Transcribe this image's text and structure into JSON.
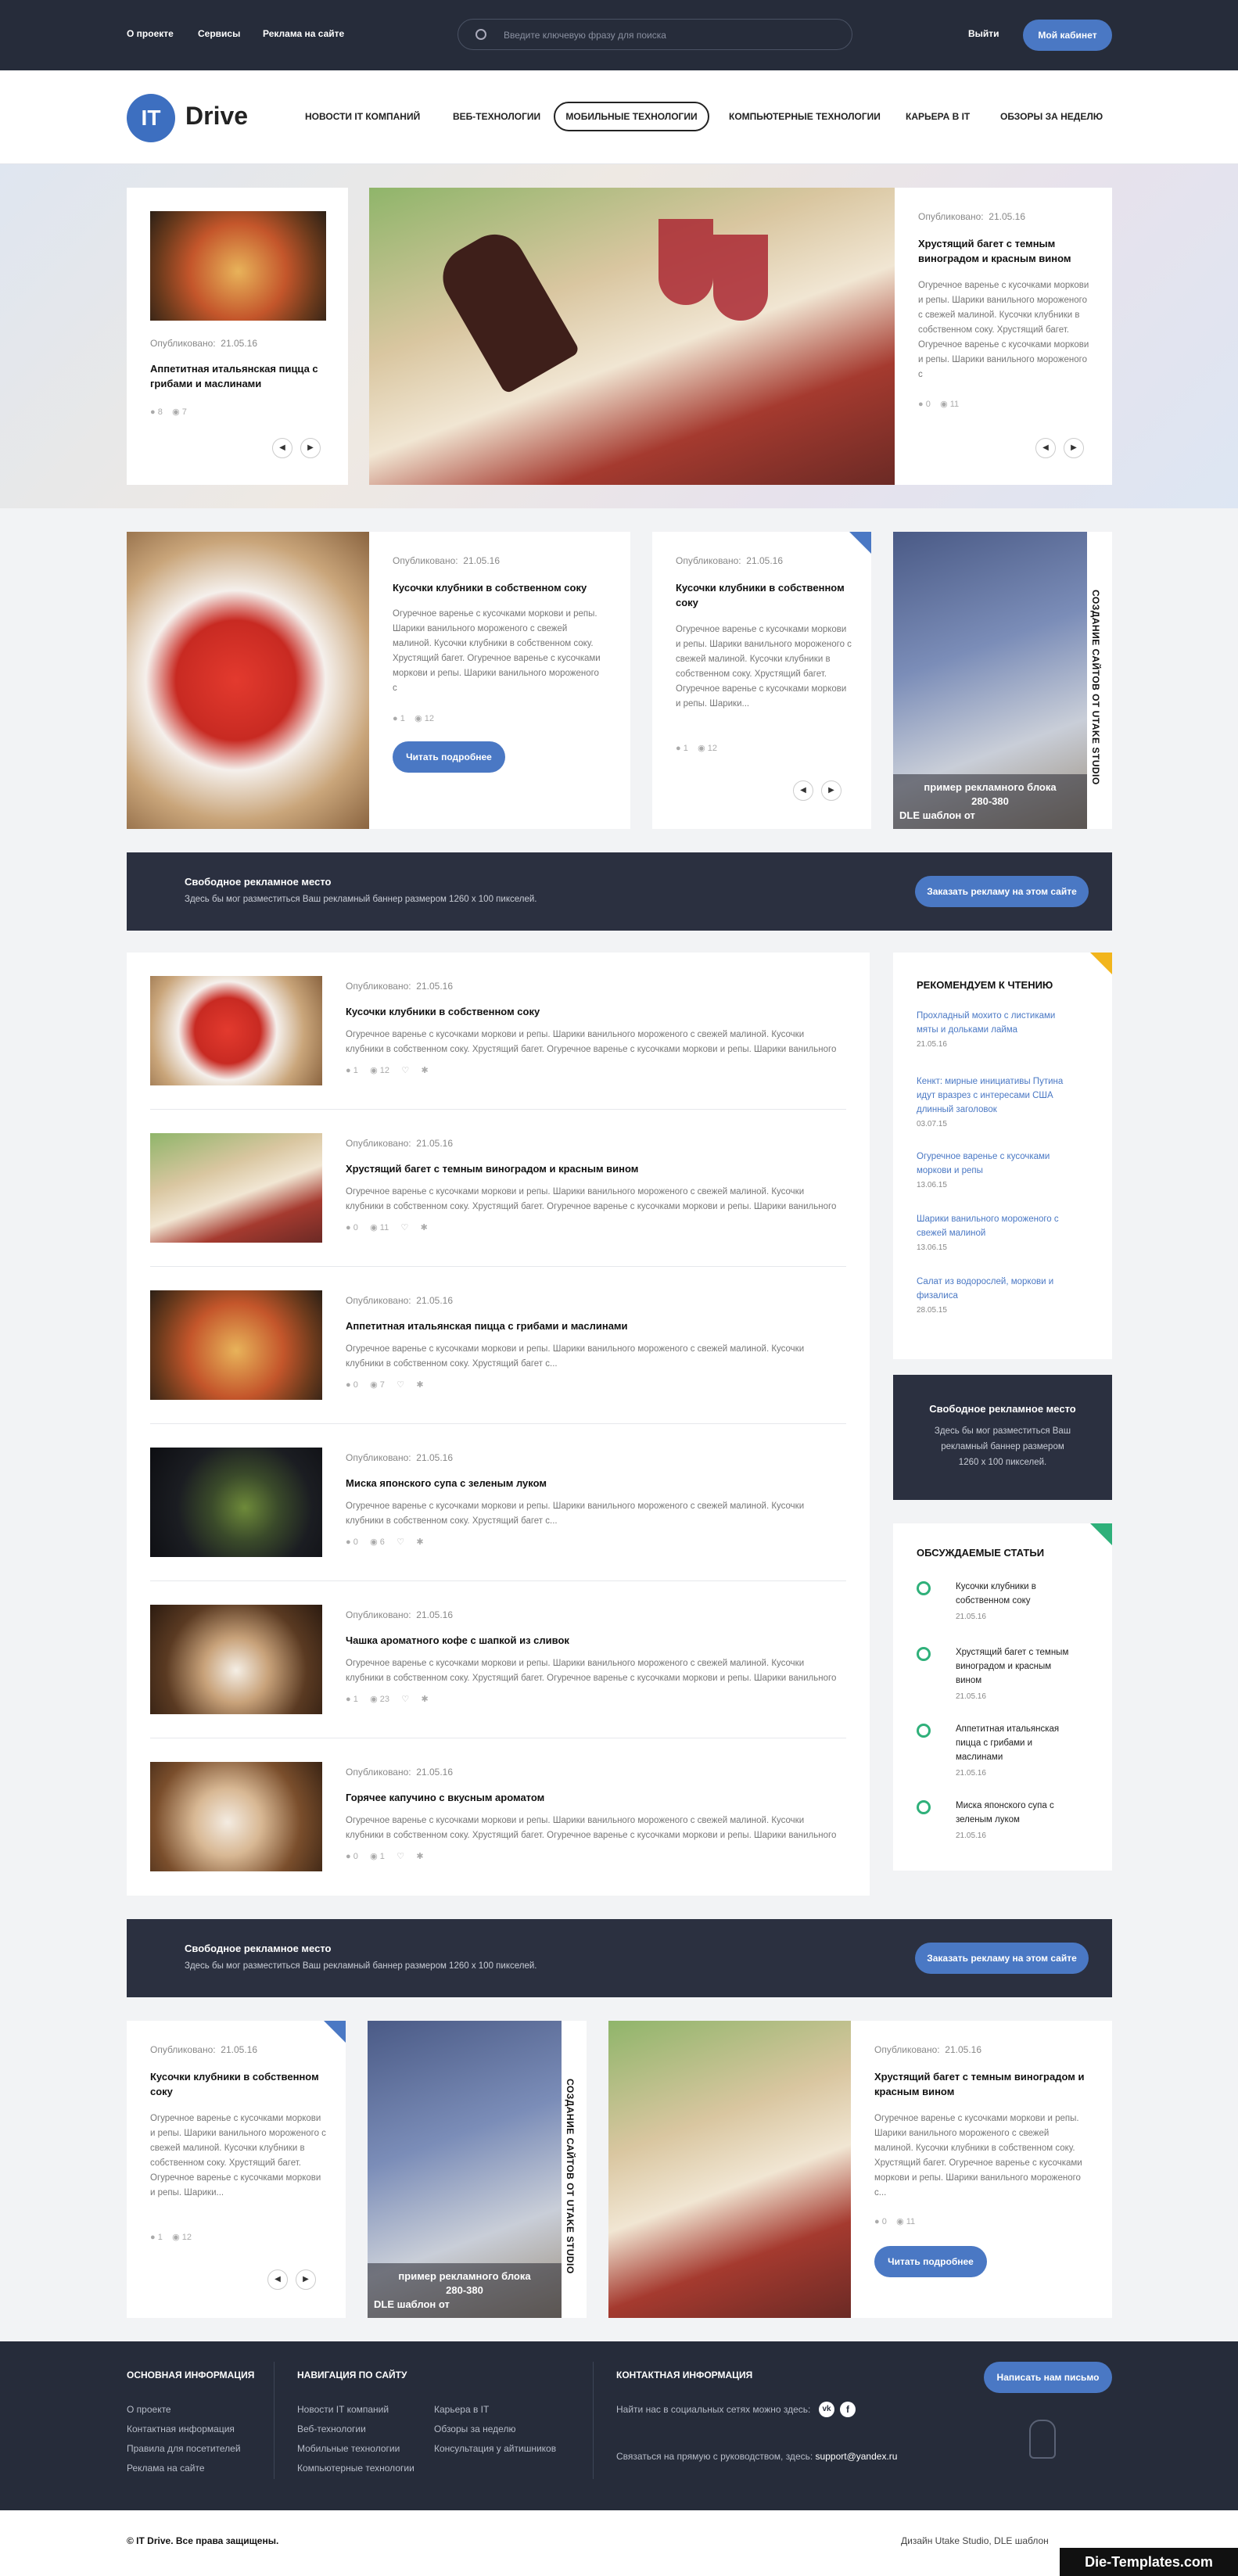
{
  "topbar": {
    "about": "О проекте",
    "services": "Сервисы",
    "ads": "Реклама на сайте",
    "search_placeholder": "Введите ключевую фразу для поиска",
    "logout": "Выйти",
    "cabinet": "Мой кабинет"
  },
  "logo": {
    "badge": "IT",
    "name": "Drive"
  },
  "nav": [
    "НОВОСТИ IT КОМПАНИЙ",
    "ВЕБ-ТЕХНОЛОГИИ",
    "МОБИЛЬНЫЕ ТЕХНОЛОГИИ",
    "КОМПЬЮТЕРНЫЕ ТЕХНОЛОГИИ",
    "КАРЬЕРА В IT",
    "ОБЗОРЫ ЗА НЕДЕЛЮ"
  ],
  "published_label": "Опубликовано:",
  "hero": {
    "left": {
      "date": "21.05.16",
      "title": "Аппетитная итальянская пицца с грибами и маслинами",
      "comments": "8",
      "views": "7"
    },
    "right": {
      "date": "21.05.16",
      "title": "Хрустящий багет с темным виноградом и красным вином",
      "text": "Огуречное варенье с кусочками моркови и репы. Шарики ванильного мороженого с свежей малиной. Кусочки клубники в собственном соку. Хрустящий багет. Огуречное варенье с кусочками моркови и репы. Шарики ванильного мороженого с",
      "comments": "0",
      "views": "11"
    }
  },
  "featured": {
    "a": {
      "date": "21.05.16",
      "title": "Кусочки клубники в собственном соку",
      "text": "Огуречное варенье с кусочками моркови и репы. Шарики ванильного мороженого с свежей малиной. Кусочки клубники в собственном соку. Хрустящий багет. Огуречное варенье с кусочками моркови и репы. Шарики ванильного мороженого с",
      "comments": "1",
      "views": "12",
      "button": "Читать подробнее"
    },
    "b": {
      "date": "21.05.16",
      "title": "Кусочки клубники в собственном соку",
      "text": "Огуречное варенье с кусочками моркови и репы. Шарики ванильного мороженого с свежей малиной. Кусочки клубники в собственном соку. Хрустящий багет. Огуречное варенье с кусочками моркови и репы. Шарики...",
      "comments": "1",
      "views": "12"
    },
    "promo": {
      "vertical": "СОЗДАНИЕ САЙТОВ ОТ UTAKE STUDIO",
      "caption1": "пример рекламного блока",
      "caption2": "280-380",
      "caption3": "DLE шаблон от"
    }
  },
  "adbanner": {
    "title": "Свободное рекламное место",
    "text": "Здесь бы мог разместиться Ваш рекламный баннер размером 1260 х 100 пикселей.",
    "button": "Заказать рекламу на этом сайте"
  },
  "articles": [
    {
      "date": "21.05.16",
      "title": "Кусочки клубники в собственном соку",
      "text": "Огуречное варенье с кусочками моркови и репы. Шарики ванильного мороженого с свежей малиной. Кусочки клубники в собственном соку. Хрустящий багет. Огуречное варенье с кусочками моркови и репы. Шарики ванильного мороженого с...",
      "comments": "1",
      "views": "12"
    },
    {
      "date": "21.05.16",
      "title": "Хрустящий багет с темным виноградом и красным вином",
      "text": "Огуречное варенье с кусочками моркови и репы. Шарики ванильного мороженого с свежей малиной. Кусочки клубники в собственном соку. Хрустящий багет. Огуречное варенье с кусочками моркови и репы. Шарики ванильного мороженого с...",
      "comments": "0",
      "views": "11"
    },
    {
      "date": "21.05.16",
      "title": "Аппетитная итальянская пицца с грибами и маслинами",
      "text": "Огуречное варенье с кусочками моркови и репы. Шарики ванильного мороженого с свежей малиной. Кусочки клубники в собственном соку. Хрустящий багет с...",
      "comments": "0",
      "views": "7"
    },
    {
      "date": "21.05.16",
      "title": "Миска японского супа с зеленым луком",
      "text": "Огуречное варенье с кусочками моркови и репы. Шарики ванильного мороженого с свежей малиной. Кусочки клубники в собственном соку. Хрустящий багет с...",
      "comments": "0",
      "views": "6"
    },
    {
      "date": "21.05.16",
      "title": "Чашка ароматного кофе с шапкой из сливок",
      "text": "Огуречное варенье с кусочками моркови и репы. Шарики ванильного мороженого с свежей малиной. Кусочки клубники в собственном соку. Хрустящий багет. Огуречное варенье с кусочками моркови и репы. Шарики ванильного мороженого с...",
      "comments": "1",
      "views": "23"
    },
    {
      "date": "21.05.16",
      "title": "Горячее капучино с вкусным ароматом",
      "text": "Огуречное варенье с кусочками моркови и репы. Шарики ванильного мороженого с свежей малиной. Кусочки клубники в собственном соку. Хрустящий багет. Огуречное варенье с кусочками моркови и репы. Шарики ванильного мороженого с...",
      "comments": "0",
      "views": "1"
    }
  ],
  "sidebar": {
    "recommend_title": "РЕКОМЕНДУЕМ К ЧТЕНИЮ",
    "recommend": [
      {
        "title": "Прохладный мохито с листиками мяты и дольками лайма",
        "date": "21.05.16"
      },
      {
        "title": "Кенкт: мирные инициативы Путина идут вразрез с интересами США длинный заголовок",
        "date": "03.07.15"
      },
      {
        "title": "Огуречное варенье с кусочками моркови и репы",
        "date": "13.06.15"
      },
      {
        "title": "Шарики ванильного мороженого с свежей малиной",
        "date": "13.06.15"
      },
      {
        "title": "Салат из водорослей, моркови и физалиса",
        "date": "28.05.15"
      }
    ],
    "ad": {
      "title": "Свободное рекламное место",
      "text": "Здесь бы мог разместиться Ваш рекламный баннер размером 1260 х 100 пикселей."
    },
    "discussed_title": "ОБСУЖДАЕМЫЕ СТАТЬИ",
    "discussed": [
      {
        "title": "Кусочки клубники в собственном соку",
        "date": "21.05.16"
      },
      {
        "title": "Хрустящий багет с темным виноградом и красным вином",
        "date": "21.05.16"
      },
      {
        "title": "Аппетитная итальянская пицца с грибами и маслинами",
        "date": "21.05.16"
      },
      {
        "title": "Миска японского супа с зеленым луком",
        "date": "21.05.16"
      }
    ]
  },
  "bottom": {
    "a": {
      "date": "21.05.16",
      "title": "Кусочки клубники в собственном соку",
      "text": "Огуречное варенье с кусочками моркови и репы. Шарики ванильного мороженого с свежей малиной. Кусочки клубники в собственном соку. Хрустящий багет. Огуречное варенье с кусочками моркови и репы. Шарики...",
      "comments": "1",
      "views": "12"
    },
    "b": {
      "date": "21.05.16",
      "title": "Хрустящий багет с темным виноградом и красным вином",
      "text": "Огуречное варенье с кусочками моркови и репы. Шарики ванильного мороженого с свежей малиной. Кусочки клубники в собственном соку. Хрустящий багет. Огуречное варенье с кусочками моркови и репы. Шарики ванильного мороженого с...",
      "comments": "0",
      "views": "11",
      "button": "Читать подробнее"
    }
  },
  "footer": {
    "col1_title": "ОСНОВНАЯ ИНФОРМАЦИЯ",
    "col1": [
      "О проекте",
      "Контактная информация",
      "Правила для посетителей",
      "Реклама на сайте"
    ],
    "col2_title": "НАВИГАЦИЯ ПО САЙТУ",
    "col2a": [
      "Новости IT компаний",
      "Веб-технологии",
      "Мобильные технологии",
      "Компьютерные технологии"
    ],
    "col2b": [
      "Карьера в IT",
      "Обзоры за неделю",
      "Консультация у айтишников"
    ],
    "col3_title": "КОНТАКТНАЯ ИНФОРМАЦИЯ",
    "social": "Найти нас в социальных сетях можно здесь:",
    "contact": "Связаться на прямую с руководством, здесь:",
    "email": "support@yandex.ru",
    "write": "Написать нам письмо"
  },
  "copyright": "© IT Drive. Все права защищены.",
  "credits": "Дизайн Utake Studio, DLE шаблон",
  "watermark": "Die-Templates.com",
  "colors": {
    "accent": "#4a78c4",
    "dark": "#262c3a"
  }
}
